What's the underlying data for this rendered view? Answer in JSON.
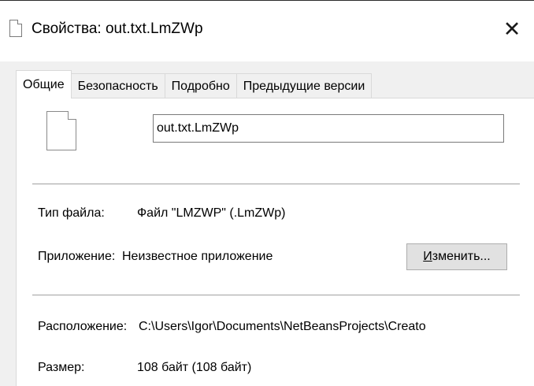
{
  "window": {
    "title": "Свойства: out.txt.LmZWp",
    "file_icon": "file-icon",
    "close_label": "✕"
  },
  "tabs": [
    {
      "label": "Общие",
      "active": true
    },
    {
      "label": "Безопасность",
      "active": false
    },
    {
      "label": "Подробно",
      "active": false
    },
    {
      "label": "Предыдущие версии",
      "active": false
    }
  ],
  "general": {
    "file_name": "out.txt.LmZWp",
    "type_label": "Тип файла:",
    "type_value": "Файл \"LMZWP\" (.LmZWp)",
    "app_label": "Приложение:",
    "app_value": "Неизвестное приложение",
    "change_button": {
      "accel": "И",
      "rest": "зменить..."
    },
    "location_label": "Расположение:",
    "location_value": "C:\\Users\\Igor\\Documents\\NetBeansProjects\\Creato",
    "size_label": "Размер:",
    "size_value": "108 байт (108 байт)"
  }
}
